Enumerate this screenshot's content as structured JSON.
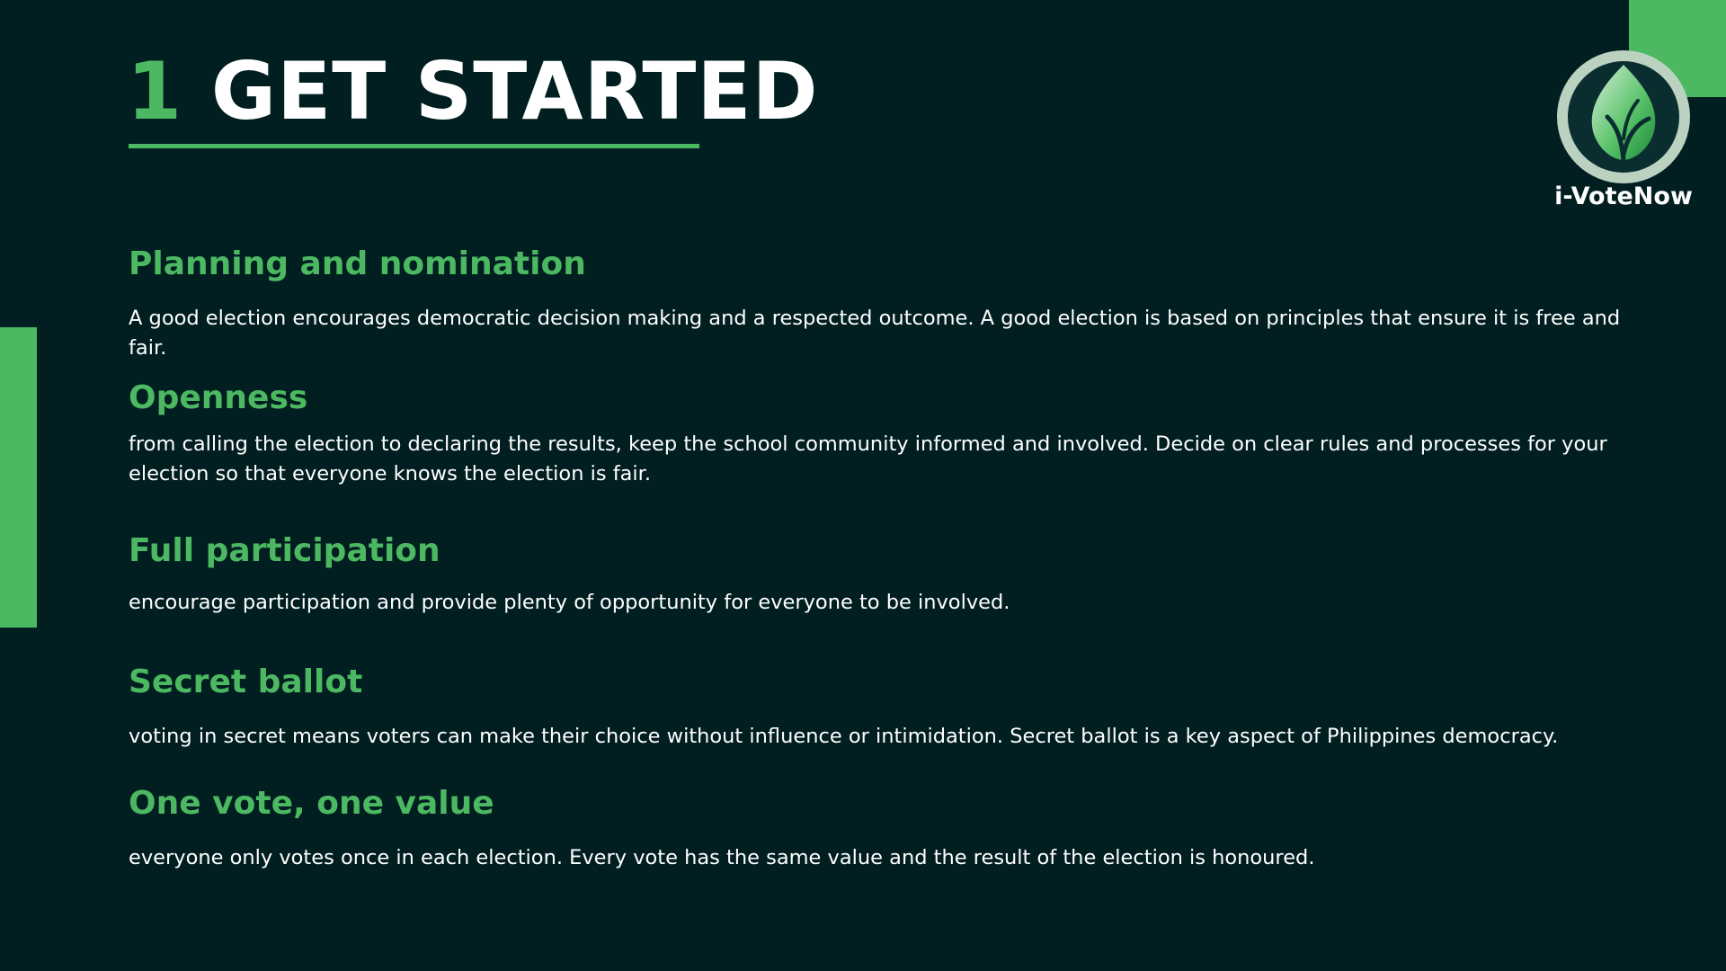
{
  "slide": {
    "number": "1",
    "title": "GET STARTED"
  },
  "logo": {
    "icon": "leaf-icon",
    "label": "i-VoteNow"
  },
  "sections": [
    {
      "heading": "Planning and nomination",
      "text": "A good election encourages democratic decision making and a respected outcome. A good election is based on principles that ensure it is free and fair."
    },
    {
      "heading": "Openness",
      "text": "from calling the election to declaring the results, keep the school community informed and involved. Decide on clear rules and processes for your election so that everyone knows the election is fair."
    },
    {
      "heading": "Full participation",
      "text": "encourage participation and provide plenty of opportunity for everyone to be involved."
    },
    {
      "heading": "Secret ballot",
      "text": "voting in secret means voters can make their choice without influence or intimidation. Secret ballot is a key aspect of Philippines democracy."
    },
    {
      "heading": "One vote, one value",
      "text": "everyone only votes once in each election. Every vote has the same value and the result of the election is honoured."
    }
  ],
  "colors": {
    "background": "#011e21",
    "accent": "#4cb861",
    "text": "#ffffff"
  }
}
